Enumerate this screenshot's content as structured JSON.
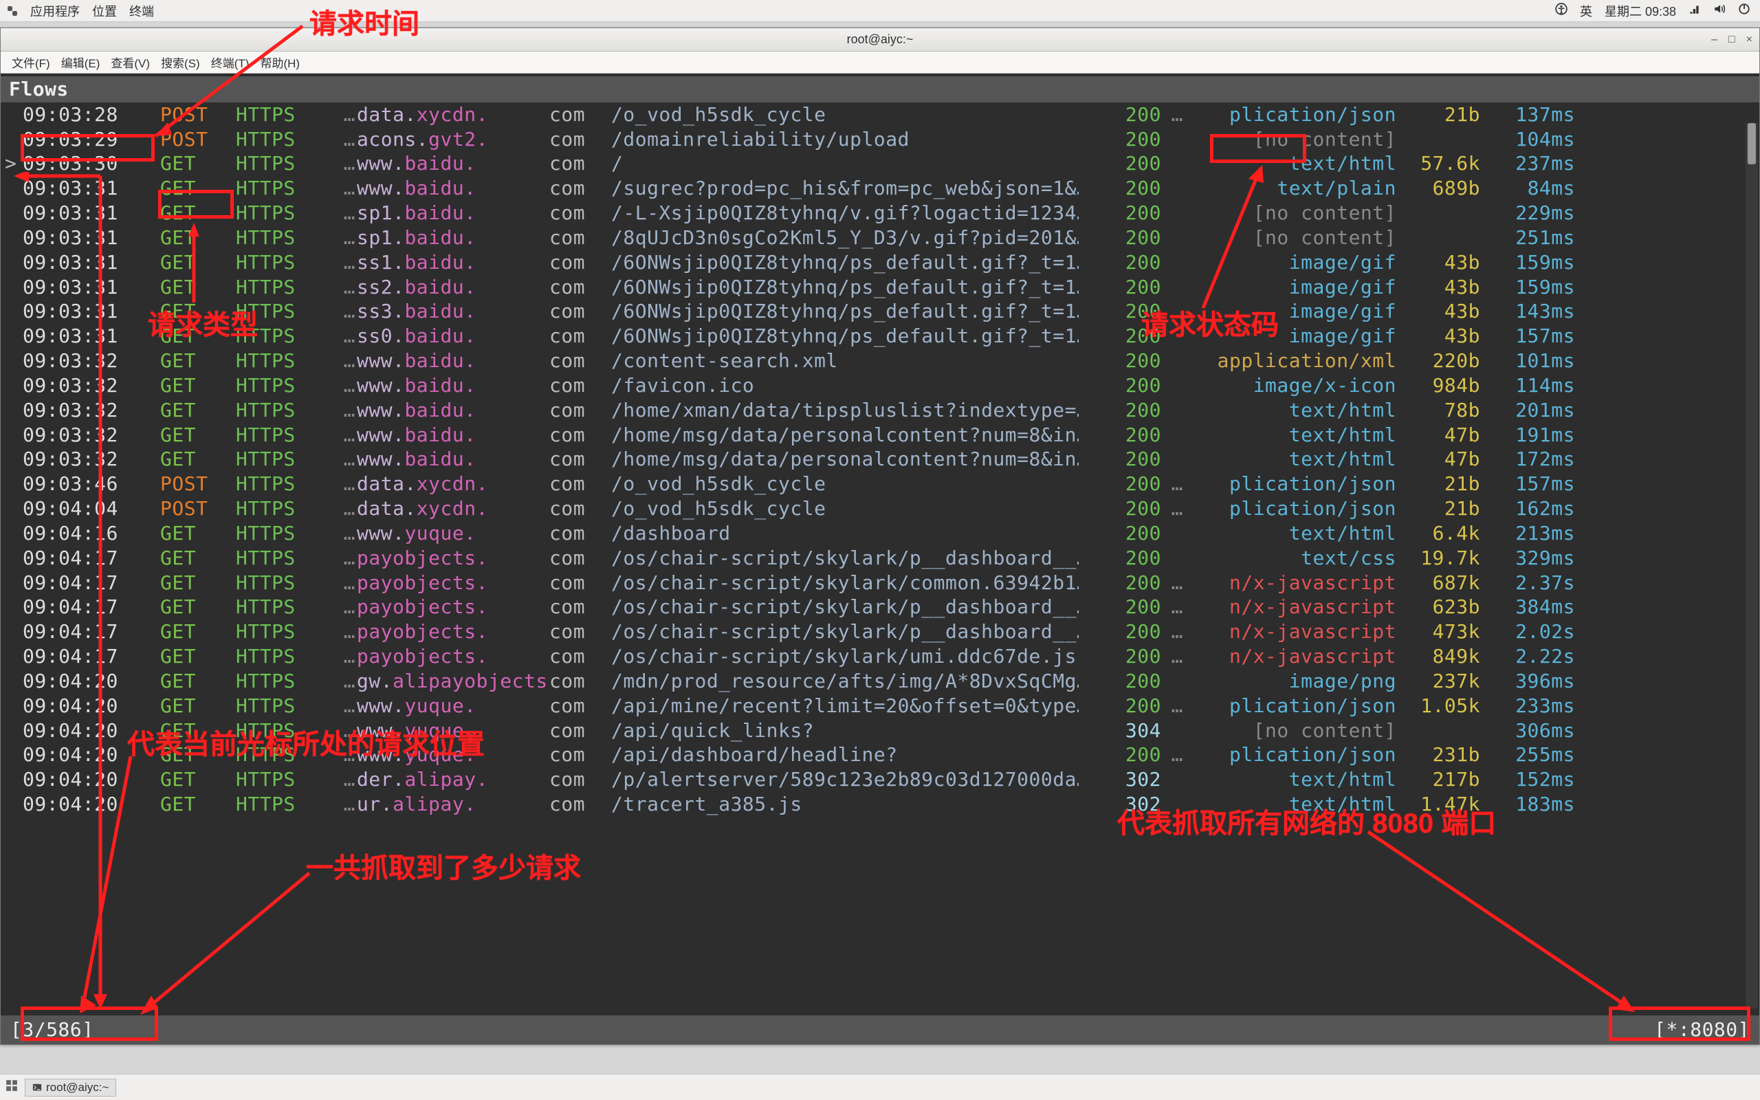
{
  "panel": {
    "apps": "应用程序",
    "places": "位置",
    "terminal": "终端",
    "ime": "英",
    "datetime": "星期二 09:38"
  },
  "window": {
    "title": "root@aiyc:~",
    "menus": [
      "文件(F)",
      "编辑(E)",
      "查看(V)",
      "搜索(S)",
      "终端(T)",
      "帮助(H)"
    ],
    "min": "–",
    "max": "□",
    "close": "×"
  },
  "flows_title": "Flows",
  "status_left": "[3/586]",
  "status_right": "[*:8080]",
  "taskbar": {
    "item": "root@aiyc:~"
  },
  "annotations": {
    "req_time": "请求时间",
    "req_type": "请求类型",
    "req_status": "请求状态码",
    "cursor_pos": "代表当前光标所处的请求位置",
    "total": "一共抓取到了多少请求",
    "port": "代表抓取所有网络的 8080 端口"
  },
  "rows": [
    {
      "caret": "",
      "t": "09:03:28",
      "m": "POST",
      "sub": "data.",
      "dom": "xycdn.",
      "tld": "com",
      "path": "/o_vod_h5sdk_cycle",
      "st": "200",
      "ct": "plication/json",
      "ctd": "…",
      "sz": "21b",
      "ms": "137ms"
    },
    {
      "caret": "",
      "t": "09:03:29",
      "m": "POST",
      "sub": "acons.",
      "dom": "gvt2.",
      "tld": "com",
      "path": "/domainreliability/upload",
      "st": "200",
      "ct": "[no content]",
      "ctd": "",
      "sz": "",
      "ms": "104ms",
      "nc": true
    },
    {
      "caret": ">",
      "t": "09:03:30",
      "m": "GET",
      "sub": "www.",
      "dom": "baidu.",
      "tld": "com",
      "path": "/",
      "st": "200",
      "ct": "text/html",
      "ctd": "",
      "sz": "57.6k",
      "ms": "237ms"
    },
    {
      "caret": "",
      "t": "09:03:31",
      "m": "GET",
      "sub": "www.",
      "dom": "baidu.",
      "tld": "com",
      "path": "/sugrec?prod=pc_his&from=pc_web&json=1&…",
      "st": "200",
      "ct": "text/plain",
      "ctd": "",
      "sz": "689b",
      "ms": "84ms"
    },
    {
      "caret": "",
      "t": "09:03:31",
      "m": "GET",
      "sub": "sp1.",
      "dom": "baidu.",
      "tld": "com",
      "path": "/-L-Xsjip0QIZ8tyhnq/v.gif?logactid=1234…",
      "st": "200",
      "ct": "[no content]",
      "ctd": "",
      "sz": "",
      "ms": "229ms",
      "nc": true
    },
    {
      "caret": "",
      "t": "09:03:31",
      "m": "GET",
      "sub": "sp1.",
      "dom": "baidu.",
      "tld": "com",
      "path": "/8qUJcD3n0sgCo2Kml5_Y_D3/v.gif?pid=201&…",
      "st": "200",
      "ct": "[no content]",
      "ctd": "",
      "sz": "",
      "ms": "251ms",
      "nc": true
    },
    {
      "caret": "",
      "t": "09:03:31",
      "m": "GET",
      "sub": "ss1.",
      "dom": "baidu.",
      "tld": "com",
      "path": "/6ONWsjip0QIZ8tyhnq/ps_default.gif?_t=1…",
      "st": "200",
      "ct": "image/gif",
      "ctd": "",
      "sz": "43b",
      "ms": "159ms"
    },
    {
      "caret": "",
      "t": "09:03:31",
      "m": "GET",
      "sub": "ss2.",
      "dom": "baidu.",
      "tld": "com",
      "path": "/6ONWsjip0QIZ8tyhnq/ps_default.gif?_t=1…",
      "st": "200",
      "ct": "image/gif",
      "ctd": "",
      "sz": "43b",
      "ms": "159ms"
    },
    {
      "caret": "",
      "t": "09:03:31",
      "m": "GET",
      "sub": "ss3.",
      "dom": "baidu.",
      "tld": "com",
      "path": "/6ONWsjip0QIZ8tyhnq/ps_default.gif?_t=1…",
      "st": "200",
      "ct": "image/gif",
      "ctd": "",
      "sz": "43b",
      "ms": "143ms"
    },
    {
      "caret": "",
      "t": "09:03:31",
      "m": "GET",
      "sub": "ss0.",
      "dom": "baidu.",
      "tld": "com",
      "path": "/6ONWsjip0QIZ8tyhnq/ps_default.gif?_t=1…",
      "st": "200",
      "ct": "image/gif",
      "ctd": "",
      "sz": "43b",
      "ms": "157ms"
    },
    {
      "caret": "",
      "t": "09:03:32",
      "m": "GET",
      "sub": "www.",
      "dom": "baidu.",
      "tld": "com",
      "path": "/content-search.xml",
      "st": "200",
      "ct": "application/xml",
      "ctd": "",
      "sz": "220b",
      "ms": "101ms",
      "app": true
    },
    {
      "caret": "",
      "t": "09:03:32",
      "m": "GET",
      "sub": "www.",
      "dom": "baidu.",
      "tld": "com",
      "path": "/favicon.ico",
      "st": "200",
      "ct": "image/x-icon",
      "ctd": "",
      "sz": "984b",
      "ms": "114ms"
    },
    {
      "caret": "",
      "t": "09:03:32",
      "m": "GET",
      "sub": "www.",
      "dom": "baidu.",
      "tld": "com",
      "path": "/home/xman/data/tipspluslist?indextype=…",
      "st": "200",
      "ct": "text/html",
      "ctd": "",
      "sz": "78b",
      "ms": "201ms"
    },
    {
      "caret": "",
      "t": "09:03:32",
      "m": "GET",
      "sub": "www.",
      "dom": "baidu.",
      "tld": "com",
      "path": "/home/msg/data/personalcontent?num=8&in…",
      "st": "200",
      "ct": "text/html",
      "ctd": "",
      "sz": "47b",
      "ms": "191ms"
    },
    {
      "caret": "",
      "t": "09:03:32",
      "m": "GET",
      "sub": "www.",
      "dom": "baidu.",
      "tld": "com",
      "path": "/home/msg/data/personalcontent?num=8&in…",
      "st": "200",
      "ct": "text/html",
      "ctd": "",
      "sz": "47b",
      "ms": "172ms"
    },
    {
      "caret": "",
      "t": "09:03:46",
      "m": "POST",
      "sub": "data.",
      "dom": "xycdn.",
      "tld": "com",
      "path": "/o_vod_h5sdk_cycle",
      "st": "200",
      "ct": "plication/json",
      "ctd": "…",
      "sz": "21b",
      "ms": "157ms"
    },
    {
      "caret": "",
      "t": "09:04:04",
      "m": "POST",
      "sub": "data.",
      "dom": "xycdn.",
      "tld": "com",
      "path": "/o_vod_h5sdk_cycle",
      "st": "200",
      "ct": "plication/json",
      "ctd": "…",
      "sz": "21b",
      "ms": "162ms"
    },
    {
      "caret": "",
      "t": "09:04:16",
      "m": "GET",
      "sub": "www.",
      "dom": "yuque.",
      "tld": "com",
      "path": "/dashboard",
      "st": "200",
      "ct": "text/html",
      "ctd": "",
      "sz": "6.4k",
      "ms": "213ms"
    },
    {
      "caret": "",
      "t": "09:04:17",
      "m": "GET",
      "sub": "",
      "dom": "payobjects.",
      "tld": "com",
      "path": "/os/chair-script/skylark/p__dashboard__…",
      "st": "200",
      "ct": "text/css",
      "ctd": "",
      "sz": "19.7k",
      "ms": "329ms"
    },
    {
      "caret": "",
      "t": "09:04:17",
      "m": "GET",
      "sub": "",
      "dom": "payobjects.",
      "tld": "com",
      "path": "/os/chair-script/skylark/common.63942b1…",
      "st": "200",
      "ct": "n/x-javascript",
      "ctd": "…",
      "sz": "687k",
      "ms": "2.37s",
      "njs": true
    },
    {
      "caret": "",
      "t": "09:04:17",
      "m": "GET",
      "sub": "",
      "dom": "payobjects.",
      "tld": "com",
      "path": "/os/chair-script/skylark/p__dashboard__…",
      "st": "200",
      "ct": "n/x-javascript",
      "ctd": "…",
      "sz": "623b",
      "ms": "384ms",
      "njs": true
    },
    {
      "caret": "",
      "t": "09:04:17",
      "m": "GET",
      "sub": "",
      "dom": "payobjects.",
      "tld": "com",
      "path": "/os/chair-script/skylark/p__dashboard__…",
      "st": "200",
      "ct": "n/x-javascript",
      "ctd": "…",
      "sz": "473k",
      "ms": "2.02s",
      "njs": true
    },
    {
      "caret": "",
      "t": "09:04:17",
      "m": "GET",
      "sub": "",
      "dom": "payobjects.",
      "tld": "com",
      "path": "/os/chair-script/skylark/umi.ddc67de.js",
      "st": "200",
      "ct": "n/x-javascript",
      "ctd": "…",
      "sz": "849k",
      "ms": "2.22s",
      "njs": true
    },
    {
      "caret": "",
      "t": "09:04:20",
      "m": "GET",
      "sub": "gw.",
      "dom": "alipayobjects.",
      "tld": "com",
      "path": "/mdn/prod_resource/afts/img/A*8DvxSqCMg…",
      "st": "200",
      "ct": "image/png",
      "ctd": "",
      "sz": "237k",
      "ms": "396ms"
    },
    {
      "caret": "",
      "t": "09:04:20",
      "m": "GET",
      "sub": "www.",
      "dom": "yuque.",
      "tld": "com",
      "path": "/api/mine/recent?limit=20&offset=0&type…",
      "st": "200",
      "ct": "plication/json",
      "ctd": "…",
      "sz": "1.05k",
      "ms": "233ms"
    },
    {
      "caret": "",
      "t": "09:04:20",
      "m": "GET",
      "sub": "www.",
      "dom": "yuque.",
      "tld": "com",
      "path": "/api/quick_links?",
      "st": "304",
      "ct": "[no content]",
      "ctd": "",
      "sz": "",
      "ms": "306ms",
      "nc": true,
      "st3": true
    },
    {
      "caret": "",
      "t": "09:04:20",
      "m": "GET",
      "sub": "www.",
      "dom": "yuque.",
      "tld": "com",
      "path": "/api/dashboard/headline?",
      "st": "200",
      "ct": "plication/json",
      "ctd": "…",
      "sz": "231b",
      "ms": "255ms"
    },
    {
      "caret": "",
      "t": "09:04:20",
      "m": "GET",
      "sub": "der.",
      "dom": "alipay.",
      "tld": "com",
      "path": "/p/alertserver/589c123e2b89c03d127000da…",
      "st": "302",
      "ct": "text/html",
      "ctd": "",
      "sz": "217b",
      "ms": "152ms",
      "st3": true
    },
    {
      "caret": "",
      "t": "09:04:20",
      "m": "GET",
      "sub": "ur.",
      "dom": "alipay.",
      "tld": "com",
      "path": "/tracert_a385.js",
      "st": "302",
      "ct": "text/html",
      "ctd": "",
      "sz": "1.47k",
      "ms": "183ms",
      "st3": true
    }
  ]
}
